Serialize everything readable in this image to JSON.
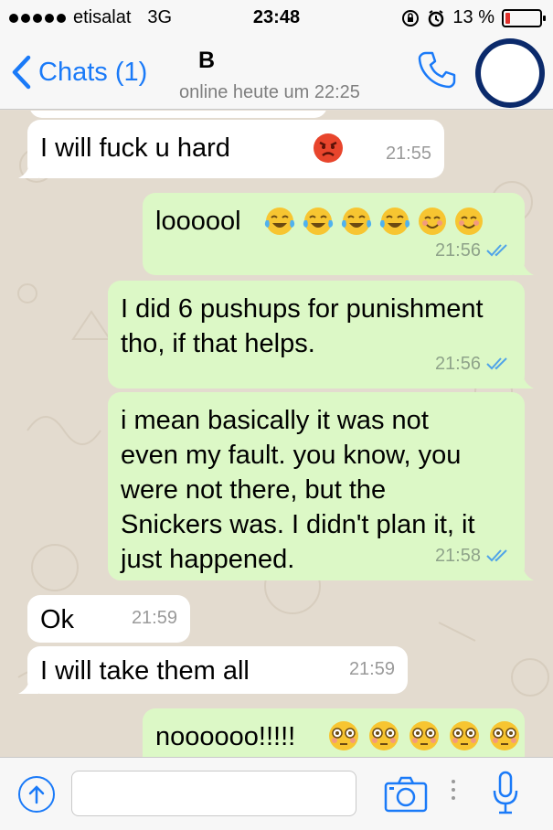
{
  "status_bar": {
    "carrier": "etisalat",
    "network": "3G",
    "time": "23:48",
    "battery": "13 %",
    "battery_level": 0.13,
    "signal_bars": 5
  },
  "header": {
    "back_label": "Chats (1)",
    "contact_name": "B",
    "contact_status": "online heute um 22:25"
  },
  "messages": [
    {
      "direction": "in",
      "text": "I will fuck u hard",
      "emoji": "angry-face-emoji",
      "time": "21:55"
    },
    {
      "direction": "out",
      "text": "loooool",
      "emoji": "tears-of-joy-x4-smile-x2",
      "time": "21:56",
      "read": true
    },
    {
      "direction": "out",
      "text": "I did 6 pushups for punishment tho, if that helps.",
      "time": "21:56",
      "read": true
    },
    {
      "direction": "out",
      "text": "i mean basically it was not even my fault. you know, you were not there, but the Snickers was. I didn't plan it, it just happened.",
      "time": "21:58",
      "read": true
    },
    {
      "direction": "in",
      "text": "Ok",
      "time": "21:59"
    },
    {
      "direction": "in",
      "text": "I will take them all",
      "time": "21:59"
    },
    {
      "direction": "out",
      "text": "noooooo!!!!!",
      "emoji": "flushed-face-x5"
    }
  ],
  "input": {
    "placeholder": "",
    "value": ""
  },
  "colors": {
    "accent": "#1a7af8",
    "outgoing_bubble": "#dcf8c6",
    "incoming_bubble": "#ffffff",
    "chat_background": "#e3dbcf",
    "read_ticks": "#4fa3e8"
  },
  "icons": [
    "back-chevron-icon",
    "phone-icon",
    "upload-arrow-icon",
    "camera-icon",
    "microphone-icon",
    "double-check-icon"
  ]
}
